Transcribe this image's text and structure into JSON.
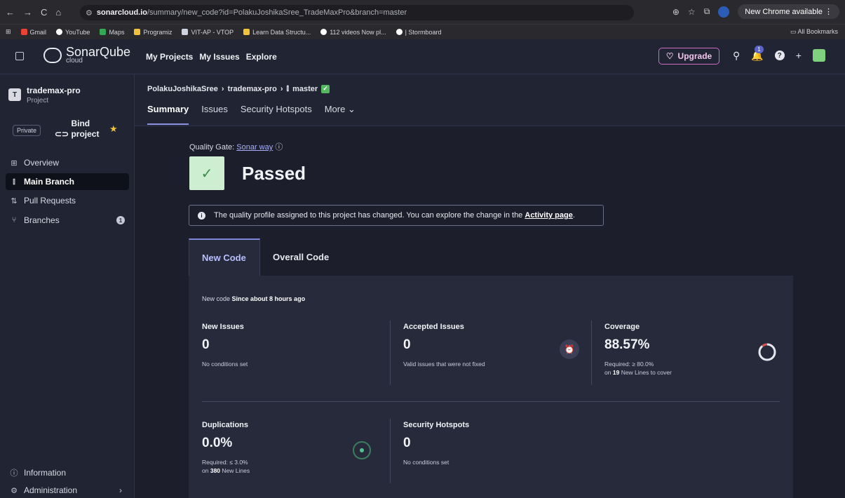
{
  "browser": {
    "nav": [
      "←",
      "→",
      "C",
      "⌂"
    ],
    "url_host": "sonarcloud.io",
    "url_path": "/summary/new_code?id=PolakuJoshikaSree_TradeMaxPro&branch=master",
    "new_chrome": "New Chrome available",
    "bookmarks": [
      {
        "label": "Gmail",
        "color": "#ea4335"
      },
      {
        "label": "YouTube",
        "color": "#ffffff"
      },
      {
        "label": "Maps",
        "color": "#34a853"
      },
      {
        "label": "Programiz",
        "color": "#f3c13a"
      },
      {
        "label": "VIT-AP - VTOP",
        "color": "#cfd3e0"
      },
      {
        "label": "Learn Data Structu...",
        "color": "#f3c13a"
      },
      {
        "label": "112 videos Now pl...",
        "color": "#ffffff"
      },
      {
        "label": "| Stormboard",
        "color": "#ffffff"
      }
    ],
    "all_bookmarks": "All Bookmarks"
  },
  "topnav": {
    "logo": "SonarQube",
    "logo_sub": "cloud",
    "menu": [
      "My Projects",
      "My Issues",
      "Explore"
    ],
    "upgrade": "Upgrade",
    "notification_count": "1",
    "help": "?"
  },
  "sidebar": {
    "project_initial": "T",
    "project_name": "trademax-pro",
    "project_type": "Project",
    "private": "Private",
    "bind": "Bind project",
    "items": [
      {
        "label": "Overview",
        "icon": "grid-icon"
      },
      {
        "label": "Main Branch",
        "icon": "branch-icon"
      },
      {
        "label": "Pull Requests",
        "icon": "pull-request-icon"
      },
      {
        "label": "Branches",
        "icon": "branches-icon",
        "badge": "1"
      }
    ],
    "bottom": [
      {
        "label": "Information",
        "icon": "info-icon"
      },
      {
        "label": "Administration",
        "icon": "gear-icon"
      }
    ]
  },
  "header": {
    "breadcrumb": [
      "PolakuJoshikaSree",
      "trademax-pro",
      "master"
    ],
    "tabs": [
      "Summary",
      "Issues",
      "Security Hotspots",
      "More"
    ]
  },
  "quality_gate": {
    "label": "Quality Gate:",
    "link": "Sonar way",
    "status": "Passed",
    "notice_text": "The quality profile assigned to this project has changed. You can explore the change in the",
    "notice_link": "Activity page",
    "status_color": "#cdeed1"
  },
  "code_tabs": [
    "New Code",
    "Overall Code"
  ],
  "panel": {
    "since_prefix": "New code",
    "since_value": "Since about 8 hours ago",
    "metrics": {
      "new_issues": {
        "title": "New Issues",
        "value": "0",
        "note": "No conditions set"
      },
      "accepted": {
        "title": "Accepted Issues",
        "value": "0",
        "note": "Valid issues that were not fixed"
      },
      "coverage": {
        "title": "Coverage",
        "value": "88.57%",
        "note1": "Required: ≥ 80.0%",
        "note2_prefix": "on",
        "note2_num": "19",
        "note2_suffix": "New Lines to cover"
      },
      "duplications": {
        "title": "Duplications",
        "value": "0.0%",
        "note1": "Required: ≤ 3.0%",
        "note2_prefix": "on",
        "note2_num": "380",
        "note2_suffix": "New Lines"
      },
      "hotspots": {
        "title": "Security Hotspots",
        "value": "0",
        "note": "No conditions set"
      }
    },
    "coverage_fraction": 0.8857
  }
}
